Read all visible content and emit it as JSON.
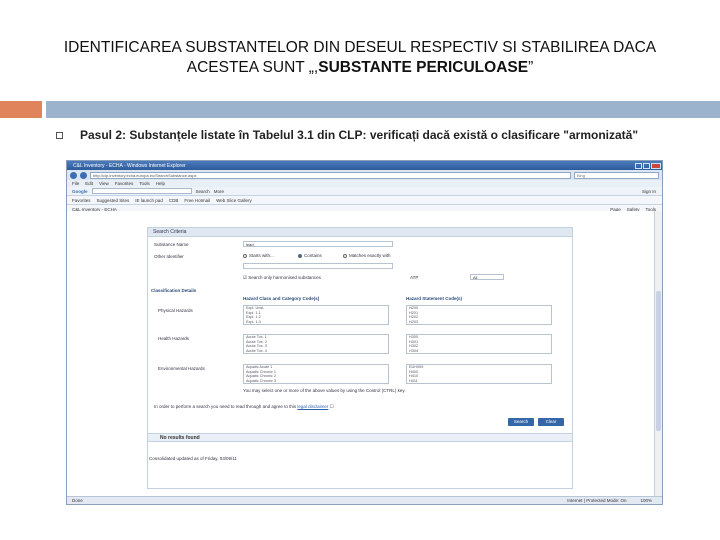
{
  "slide": {
    "title_line1": "IDENTIFICAREA SUBSTANTELOR DIN DESEUL RESPECTIV SI STABILIREA DACA",
    "title_line2_prefix": "ACESTEA SUNT „,",
    "title_line2_bold": "SUBSTANTE PERICULOASE",
    "title_line2_suffix": "”",
    "step_text": "Pasul 2: Substanțele listate în Tabelul 3.1 din CLP: verificați dacă există o clasificare \"armonizată\"",
    "accent_orange": "#e0855b",
    "accent_blue": "#9bb3cd"
  },
  "browser": {
    "window_title": "C&L Inventory - ECHA - Windows Internet Explorer",
    "url": "http://clp-inventory.echa.europa.eu/SearchSubstance.aspx",
    "search_placeholder": "Bing",
    "menu": [
      "File",
      "Edit",
      "View",
      "Favorites",
      "Tools",
      "Help"
    ],
    "google_label": "Google",
    "google_right": [
      "Search",
      "More",
      "Sign In"
    ],
    "favorites": [
      "Favorites",
      "Suggested Sites",
      "IE launch pad",
      "CDB",
      "Free Hotmail",
      "Web Slice Gallery"
    ],
    "tab_label": "C&L Inventory - ECHA",
    "toolbar_right": [
      "Page",
      "Safety",
      "Tools"
    ],
    "status_left": "Done",
    "status_right": "Internet | Protected Mode: On",
    "zoom": "100%"
  },
  "form": {
    "header": "Search Criteria",
    "substance_name_label": "Substance Name",
    "substance_name_value": "lead",
    "other_identifier_label": "Other Identifier",
    "radio_options": [
      "Starts with...",
      "Contains",
      "Matches exactly with"
    ],
    "harmonised_checkbox": "Search only harmonised substances",
    "atp_label": "ATP",
    "atp_value": "All",
    "classification_header": "Classification Details",
    "hazard_class_header": "Hazard Class and Category Code(s)",
    "hazard_statement_header": "Hazard Statement Code(s)",
    "physical_label": "Physical Hazards",
    "health_label": "Health Hazards",
    "env_label": "Environmental Hazards",
    "physical_classes": [
      "Expl. Unst.",
      "Expl. 1.1",
      "Expl. 1.2",
      "Expl. 1.3"
    ],
    "physical_statements": [
      "H200",
      "H201",
      "H202",
      "H203"
    ],
    "health_classes": [
      "Acute Tox. 1",
      "Acute Tox. 2",
      "Acute Tox. 3",
      "Acute Tox. 4"
    ],
    "health_statements": [
      "H300",
      "H301",
      "H302",
      "H304"
    ],
    "env_classes": [
      "Aquatic Acute 1",
      "Aquatic Chronic 1",
      "Aquatic Chronic 2",
      "Aquatic Chronic 3"
    ],
    "env_statements": [
      "EUH059",
      "H400",
      "H410",
      "H411"
    ],
    "hint": "You may select one or more of the above values by using the Control (CTRL) key.",
    "legal_text": "In order to perform a search you need to read through and agree to this",
    "legal_link": "legal disclaimer",
    "search_button": "Search",
    "clear_button": "Clear",
    "no_results": "No results found",
    "footer_note": "Consolidated updated as of Friday, 03/09/11"
  }
}
